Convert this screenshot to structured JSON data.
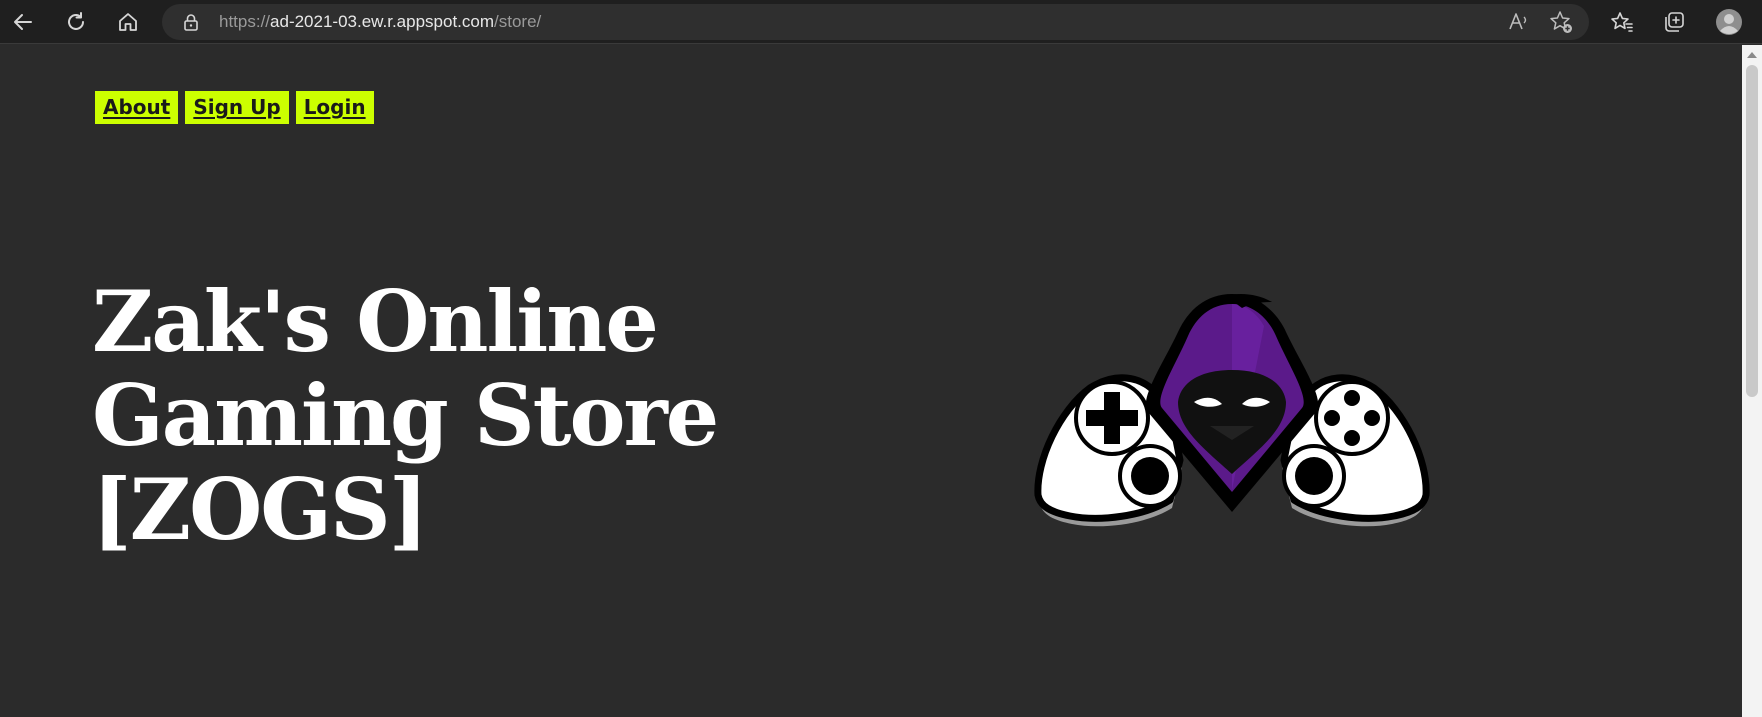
{
  "browser": {
    "url": {
      "scheme": "https://",
      "host": "ad-2021-03.ew.r.appspot.com",
      "path": "/store/"
    },
    "icons": {
      "back": "back-arrow-icon",
      "refresh": "refresh-icon",
      "home": "home-icon",
      "lock": "lock-icon",
      "read_aloud": "read-aloud-icon",
      "add_favorite": "add-favorite-icon",
      "favorites": "favorites-icon",
      "collections": "collections-icon",
      "profile": "profile-icon"
    }
  },
  "site": {
    "nav": [
      {
        "label": "About"
      },
      {
        "label": "Sign Up"
      },
      {
        "label": "Login"
      }
    ],
    "title": "Zak's Online Gaming Store [ZOGS]",
    "logo": "hooded-gamer-controller-logo"
  },
  "colors": {
    "background": "#2b2b2b",
    "nav_button": "#ccff00",
    "title": "#ffffff",
    "logo_purple": "#5b1a8a"
  }
}
